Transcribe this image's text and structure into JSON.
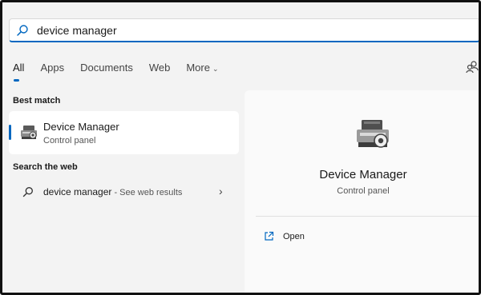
{
  "search": {
    "value": "device manager"
  },
  "tabs": [
    {
      "label": "All",
      "active": true
    },
    {
      "label": "Apps"
    },
    {
      "label": "Documents"
    },
    {
      "label": "Web"
    },
    {
      "label": "More"
    }
  ],
  "best_match": {
    "section_label": "Best match",
    "title": "Device Manager",
    "subtitle": "Control panel"
  },
  "web_search": {
    "section_label": "Search the web",
    "query": "device manager",
    "hint": " - See web results"
  },
  "preview": {
    "title": "Device Manager",
    "subtitle": "Control panel",
    "actions": [
      {
        "label": "Open"
      }
    ]
  },
  "colors": {
    "accent": "#0067c0",
    "background": "#f3f3f3",
    "card": "#ffffff"
  },
  "icons": {
    "search": "search-icon",
    "more": "chevron-down-icon",
    "top_right": "connected-accounts-icon",
    "app": "device-manager-icon",
    "web_arrow": "chevron-right-icon",
    "open": "open-external-icon"
  }
}
